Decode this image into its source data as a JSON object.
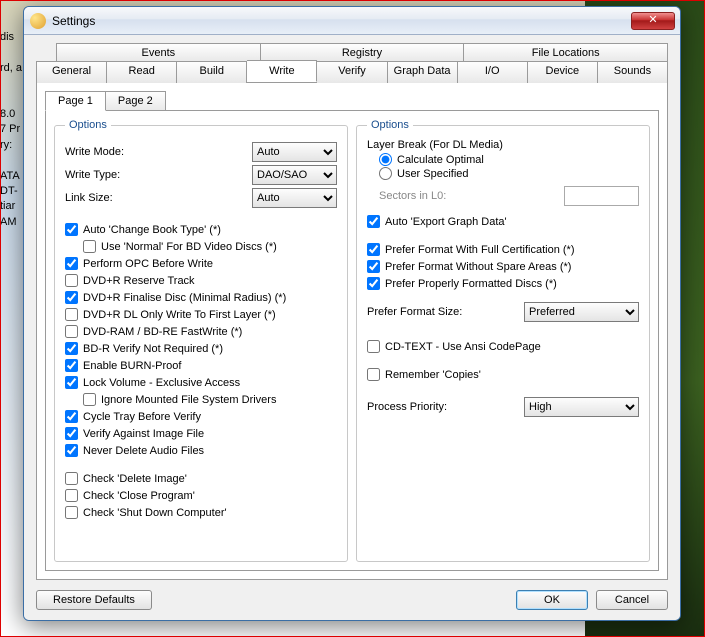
{
  "window": {
    "title": "Settings"
  },
  "tabs_top": [
    "Events",
    "Registry",
    "File Locations"
  ],
  "tabs_bottom": [
    "General",
    "Read",
    "Build",
    "Write",
    "Verify",
    "Graph Data",
    "I/O",
    "Device",
    "Sounds"
  ],
  "active_tab": "Write",
  "subtabs": [
    "Page 1",
    "Page 2"
  ],
  "active_subtab": "Page 1",
  "left": {
    "legend": "Options",
    "write_mode": {
      "label": "Write Mode:",
      "value": "Auto"
    },
    "write_type": {
      "label": "Write Type:",
      "value": "DAO/SAO"
    },
    "link_size": {
      "label": "Link Size:",
      "value": "Auto"
    },
    "checks1": [
      {
        "label": "Auto 'Change Book Type' (*)",
        "checked": true
      },
      {
        "label": "Use 'Normal' For BD Video Discs (*)",
        "checked": false,
        "indent": true
      },
      {
        "label": "Perform OPC Before Write",
        "checked": true
      },
      {
        "label": "DVD+R Reserve Track",
        "checked": false
      },
      {
        "label": "DVD+R Finalise Disc (Minimal Radius) (*)",
        "checked": true
      },
      {
        "label": "DVD+R DL Only Write To First Layer (*)",
        "checked": false
      },
      {
        "label": "DVD-RAM / BD-RE FastWrite (*)",
        "checked": false
      },
      {
        "label": "BD-R Verify Not Required (*)",
        "checked": true
      },
      {
        "label": "Enable BURN-Proof",
        "checked": true
      },
      {
        "label": "Lock Volume - Exclusive Access",
        "checked": true
      },
      {
        "label": "Ignore Mounted File System Drivers",
        "checked": false,
        "indent": true
      },
      {
        "label": "Cycle Tray Before Verify",
        "checked": true
      },
      {
        "label": "Verify Against Image File",
        "checked": true
      },
      {
        "label": "Never Delete Audio Files",
        "checked": true
      }
    ],
    "checks2": [
      {
        "label": "Check 'Delete Image'",
        "checked": false
      },
      {
        "label": "Check 'Close Program'",
        "checked": false
      },
      {
        "label": "Check 'Shut Down Computer'",
        "checked": false
      }
    ]
  },
  "right": {
    "legend": "Options",
    "layer_break_label": "Layer Break (For DL Media)",
    "radios": [
      {
        "label": "Calculate Optimal",
        "checked": true
      },
      {
        "label": "User Specified",
        "checked": false
      }
    ],
    "sectors_label": "Sectors in L0:",
    "sectors_value": "",
    "auto_export": {
      "label": "Auto 'Export Graph Data'",
      "checked": true
    },
    "prefer_checks": [
      {
        "label": "Prefer Format With Full Certification (*)",
        "checked": true
      },
      {
        "label": "Prefer Format Without Spare Areas (*)",
        "checked": true
      },
      {
        "label": "Prefer Properly Formatted Discs (*)",
        "checked": true
      }
    ],
    "prefer_format_size": {
      "label": "Prefer Format Size:",
      "value": "Preferred"
    },
    "cdtext": {
      "label": "CD-TEXT - Use Ansi CodePage",
      "checked": false
    },
    "remember_copies": {
      "label": "Remember 'Copies'",
      "checked": false
    },
    "process_priority": {
      "label": "Process Priority:",
      "value": "High"
    }
  },
  "footer": {
    "restore": "Restore Defaults",
    "ok": "OK",
    "cancel": "Cancel"
  },
  "background_text": "dis\n\nrd, a\n\n\n8.0\n7 Pr\nry:\n\nATA\nDT-\ntiar\nAM"
}
